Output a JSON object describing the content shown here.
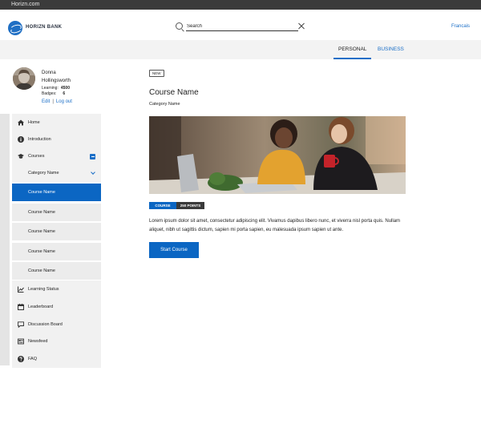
{
  "browser": {
    "title": "Horizn.com"
  },
  "header": {
    "brand": "HORIZN BANK",
    "search_value": "Search",
    "lang_label": "Francais"
  },
  "subnav": {
    "tabs": [
      {
        "label": "PERSONAL",
        "active": true
      },
      {
        "label": "BUSINESS",
        "active": false
      }
    ]
  },
  "profile": {
    "first_name": "Donna",
    "last_name": "Hollingsworth",
    "learning_label": "Learning:",
    "learning_value": "4500",
    "badges_label": "Badges:",
    "badges_value": "6",
    "edit_label": "Edit",
    "logout_label": "Log out"
  },
  "sidebar": {
    "items": [
      {
        "label": "Home",
        "icon": "home-icon"
      },
      {
        "label": "Introduction",
        "icon": "info-icon"
      },
      {
        "label": "Courses",
        "icon": "graduation-cap-icon"
      },
      {
        "label": "Category Name",
        "icon": "chevron-down-icon"
      },
      {
        "label": "Course Name",
        "active": true
      },
      {
        "label": "Course Name"
      },
      {
        "label": "Course Name"
      },
      {
        "label": "Course Name"
      },
      {
        "label": "Course Name"
      },
      {
        "label": "Learning Status",
        "icon": "chart-line-icon"
      },
      {
        "label": "Leaderboard",
        "icon": "calendar-icon"
      },
      {
        "label": "Discussion Board",
        "icon": "comment-icon"
      },
      {
        "label": "Newsfeed",
        "icon": "newspaper-icon"
      },
      {
        "label": "FAQ",
        "icon": "question-icon"
      }
    ]
  },
  "main": {
    "new_badge": "NEW",
    "course_title": "Course Name",
    "category": "Category Name",
    "tag_type": "COURSE",
    "tag_points": "250 POINTS",
    "description": "Lorem ipsum dolor sit amet, consectetur adipiscing elit. Vivamus dapibus libero nunc, et viverra nisl porta quis. Nullam aliquet, nibh ut sagittis dictum, sapien mi porta sapien, eu malesuada ipsum sapien ut ante.",
    "start_label": "Start Course"
  },
  "colors": {
    "accent": "#0b66c3",
    "topbar": "#3b3b3b",
    "subnav_bg": "#f3f3f3",
    "sidebar_bg": "#f1f1f1"
  }
}
